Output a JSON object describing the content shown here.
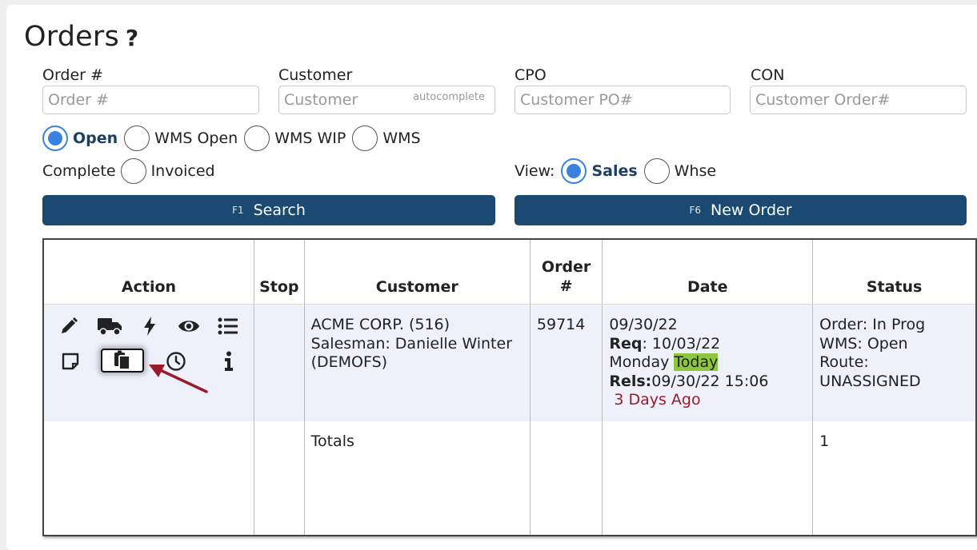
{
  "page": {
    "title": "Orders",
    "help_glyph": "?"
  },
  "filters": {
    "order": {
      "label": "Order #",
      "placeholder": "Order #"
    },
    "customer": {
      "label": "Customer",
      "placeholder": "Customer",
      "hint": "autocomplete"
    },
    "cpo": {
      "label": "CPO",
      "placeholder": "Customer PO#"
    },
    "con": {
      "label": "CON",
      "placeholder": "Customer Order#"
    }
  },
  "status_options": [
    {
      "label": "Open",
      "selected": true
    },
    {
      "label": "WMS Open",
      "selected": false
    },
    {
      "label": "WMS WIP",
      "selected": false
    },
    {
      "label": "WMS",
      "selected": false
    },
    {
      "label": "Complete",
      "selected": false
    },
    {
      "label": "Invoiced",
      "selected": false
    }
  ],
  "view": {
    "label": "View:",
    "options": [
      {
        "label": "Sales",
        "selected": true
      },
      {
        "label": "Whse",
        "selected": false
      }
    ]
  },
  "buttons": {
    "search": {
      "fkey": "F1",
      "label": "Search"
    },
    "new_order": {
      "fkey": "F6",
      "label": "New Order"
    }
  },
  "table": {
    "headers": {
      "action": "Action",
      "stop": "Stop",
      "customer": "Customer",
      "order_line1": "Order",
      "order_line2": "#",
      "date": "Date",
      "status": "Status"
    },
    "row": {
      "customer_line1": "ACME CORP. (516)",
      "customer_line2": "Salesman: Danielle Winter",
      "customer_line3": "(DEMOFS)",
      "order_no": "59714",
      "date": "09/30/22",
      "req_label": "Req",
      "req_value": ": 10/03/22",
      "weekday": "Monday",
      "today": "Today",
      "rels_label": "Rels:",
      "rels_value": "09/30/22 15:06",
      "ago": "3 Days Ago",
      "status_order": "Order: In Prog",
      "status_wms": "WMS: Open",
      "status_route_label": "Route:",
      "status_route_value": "UNASSIGNED"
    },
    "totals": {
      "label": "Totals",
      "status_count": "1"
    },
    "action_icons": [
      "pencil-icon",
      "truck-icon",
      "bolt-icon",
      "eye-icon",
      "list-icon",
      "note-icon",
      "copy-icon",
      "clock-icon",
      "info-icon"
    ]
  },
  "colors": {
    "button_bg": "#1a4a72",
    "radio_on": "#3a82e0",
    "today_highlight": "#8dc63f",
    "ago_text": "#9a1c2c",
    "arrow": "#9a1c2c"
  }
}
